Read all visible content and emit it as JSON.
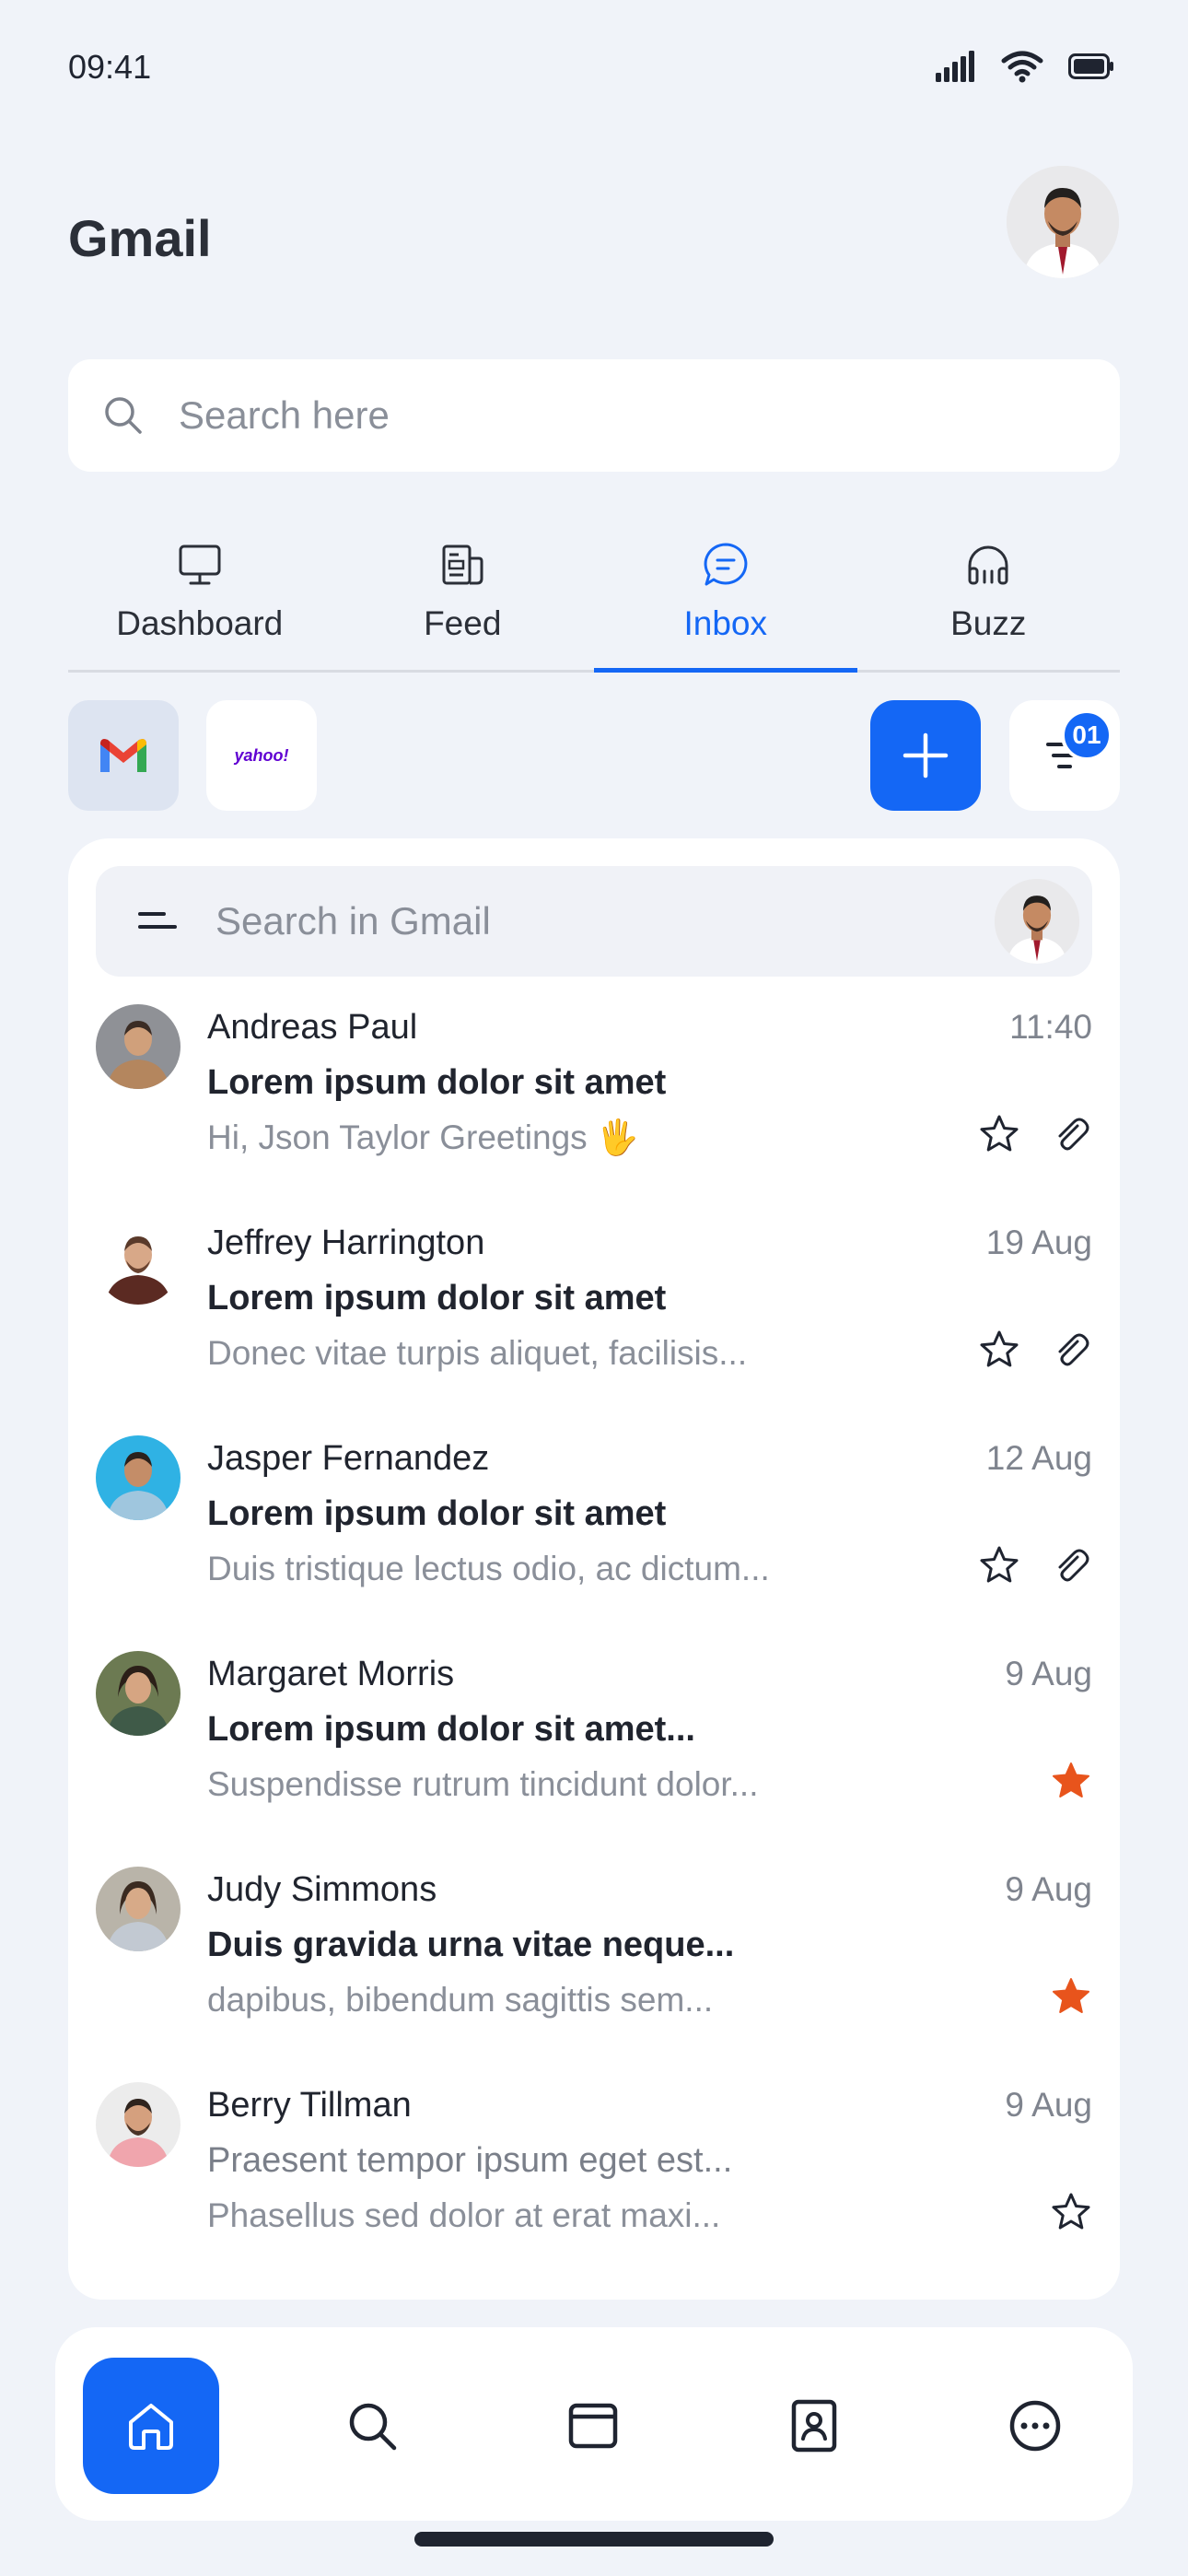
{
  "status_bar": {
    "time": "09:41"
  },
  "header": {
    "title": "Gmail"
  },
  "search": {
    "placeholder": "Search here"
  },
  "tabs": [
    {
      "label": "Dashboard",
      "icon": "monitor-icon",
      "active": false
    },
    {
      "label": "Feed",
      "icon": "newspaper-icon",
      "active": false
    },
    {
      "label": "Inbox",
      "icon": "chat-bubble-icon",
      "active": true
    },
    {
      "label": "Buzz",
      "icon": "headphones-icon",
      "active": false
    }
  ],
  "accounts": [
    {
      "name": "gmail",
      "icon": "gmail-logo"
    },
    {
      "name": "yahoo",
      "label": "yahoo!"
    }
  ],
  "filter": {
    "badge": "01"
  },
  "gmail_search": {
    "placeholder": "Search in Gmail"
  },
  "emails": [
    {
      "sender": "Andreas Paul",
      "date": "11:40",
      "subject": "Lorem ipsum dolor sit amet",
      "preview": "Hi, Json Taylor Greetings 🖐",
      "starred": false,
      "attachment": true,
      "read": false
    },
    {
      "sender": "Jeffrey Harrington",
      "date": "19 Aug",
      "subject": "Lorem ipsum dolor sit amet",
      "preview": "Donec vitae turpis aliquet, facilisis...",
      "starred": false,
      "attachment": true,
      "read": false
    },
    {
      "sender": "Jasper Fernandez",
      "date": "12 Aug",
      "subject": "Lorem ipsum dolor sit amet",
      "preview": "Duis tristique lectus odio, ac dictum...",
      "starred": false,
      "attachment": true,
      "read": false
    },
    {
      "sender": "Margaret Morris",
      "date": "9 Aug",
      "subject": "Lorem ipsum dolor sit amet...",
      "preview": "Suspendisse rutrum tincidunt dolor...",
      "starred": true,
      "attachment": false,
      "read": false
    },
    {
      "sender": "Judy Simmons",
      "date": "9 Aug",
      "subject": "Duis gravida urna vitae neque...",
      "preview": "dapibus, bibendum sagittis sem...",
      "starred": true,
      "attachment": false,
      "read": false
    },
    {
      "sender": "Berry Tillman",
      "date": "9 Aug",
      "subject": "Praesent tempor ipsum eget est...",
      "preview": "Phasellus sed dolor at erat maxi...",
      "starred": false,
      "attachment": false,
      "read": true
    }
  ],
  "bottom_nav": [
    {
      "icon": "home-icon",
      "active": true
    },
    {
      "icon": "search-icon",
      "active": false
    },
    {
      "icon": "window-icon",
      "active": false
    },
    {
      "icon": "contacts-book-icon",
      "active": false
    },
    {
      "icon": "more-icon",
      "active": false
    }
  ],
  "colors": {
    "accent": "#1467f5",
    "star_filled": "#e8541c",
    "background": "#f0f3f9"
  }
}
